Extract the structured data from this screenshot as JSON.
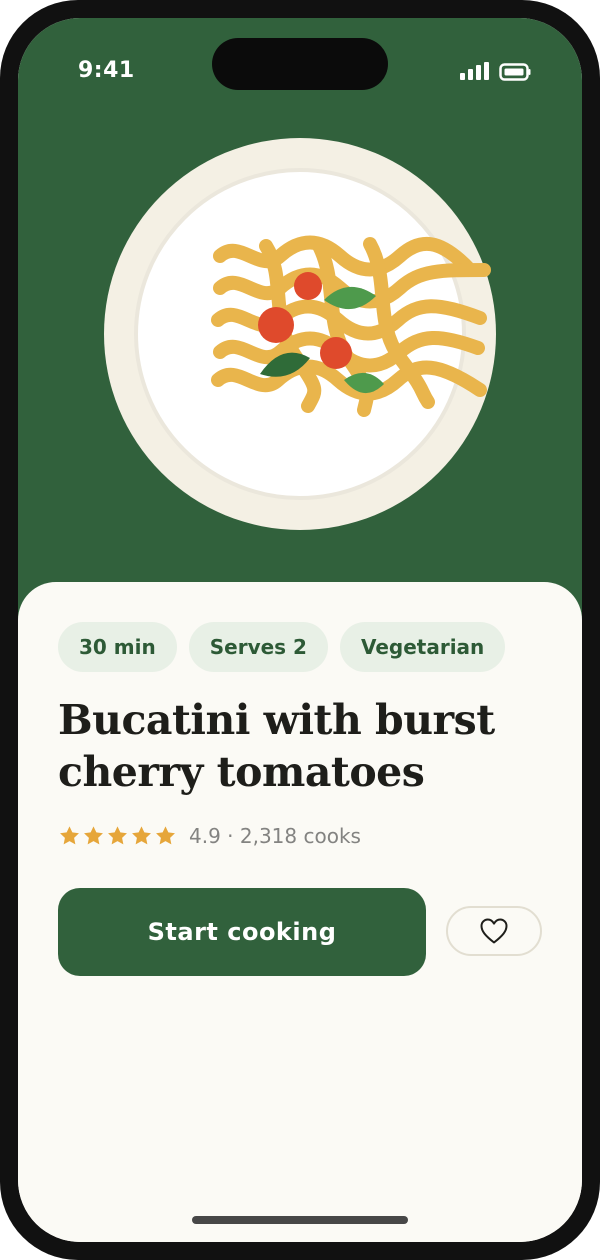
{
  "status_bar": {
    "time": "9:41",
    "icons": [
      "signal-icon",
      "battery-icon"
    ]
  },
  "hero": {
    "image": "pasta-plate-illustration",
    "background_color": "#31613c"
  },
  "recipe": {
    "tags": [
      "30 min",
      "Serves 2",
      "Vegetarian"
    ],
    "title": "Bucatini with burst cherry tomatoes",
    "rating": {
      "stars": 5,
      "text": "4.9 · 2,318 cooks"
    }
  },
  "actions": {
    "start_label": "Start cooking",
    "favorite_icon": "heart-icon"
  },
  "colors": {
    "accent": "#31613c",
    "star": "#e6a63a",
    "chip_bg": "#e8f0e6",
    "sheet_bg": "#fbfaf5"
  }
}
